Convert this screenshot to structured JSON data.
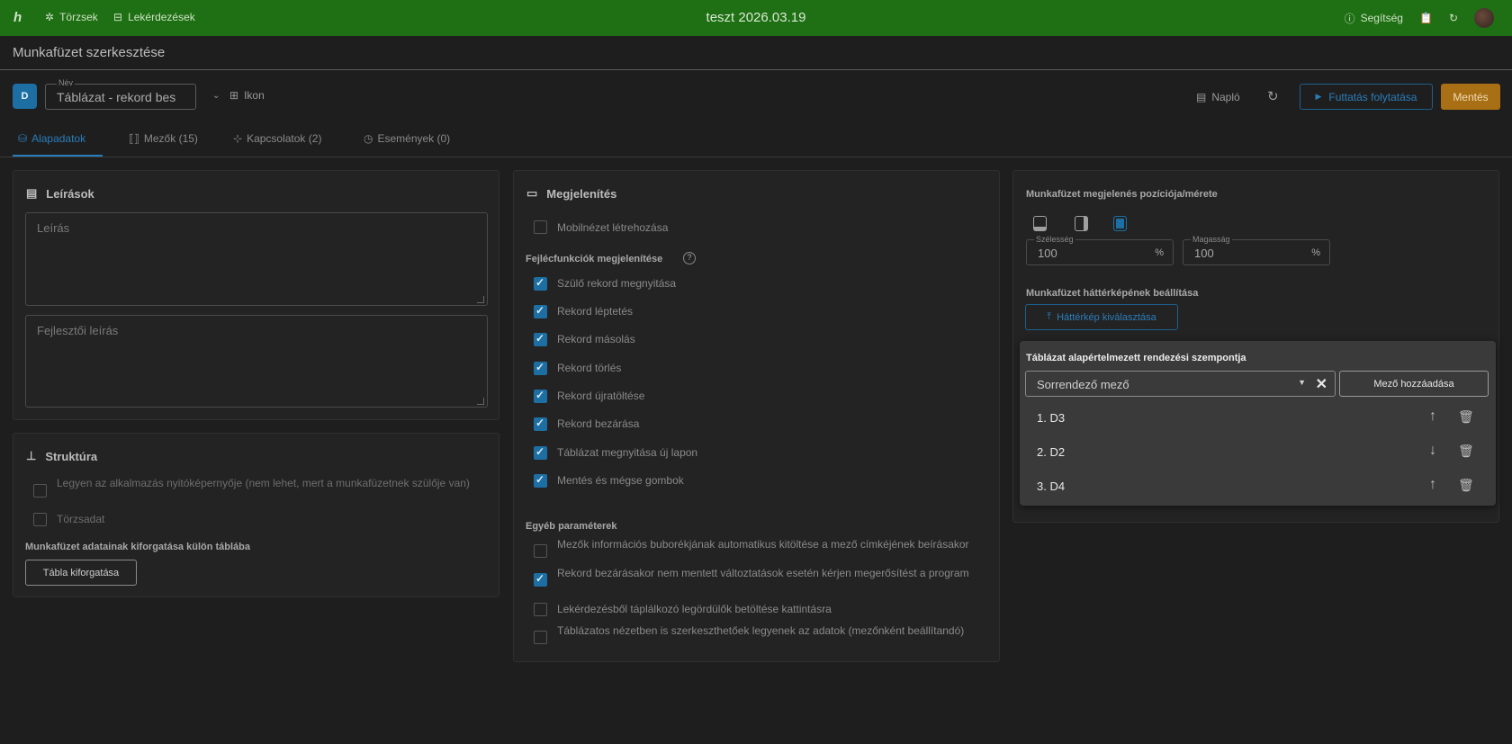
{
  "topbar": {
    "logo": "h",
    "nav_torzsek": "Törzsek",
    "nav_lekerdezesek": "Lekérdezések",
    "title": "teszt 2026.03.19",
    "help": "Segítség"
  },
  "header": {
    "page_title": "Munkafüzet szerkesztése",
    "badge": "D",
    "name_label": "Név",
    "name_value": "Táblázat - rekord bes",
    "icon_label": "Ikon",
    "log_label": "Napló",
    "run_label": "Futtatás folytatása",
    "save_label": "Mentés"
  },
  "tabs": [
    {
      "label": "Alapadatok",
      "active": true
    },
    {
      "label": "Mezők (15)"
    },
    {
      "label": "Kapcsolatok (2)"
    },
    {
      "label": "Események (0)"
    }
  ],
  "descriptions": {
    "title": "Leírások",
    "description_placeholder": "Leírás",
    "dev_description_placeholder": "Fejlesztői leírás"
  },
  "structure": {
    "title": "Struktúra",
    "start_screen": "Legyen az alkalmazás nyitóképernyője (nem lehet, mert a munkafüzetnek szülője van)",
    "master_data": "Törzsadat",
    "rollout_heading": "Munkafüzet adatainak kiforgatása külön táblába",
    "rollout_button": "Tábla kiforgatása"
  },
  "display": {
    "title": "Megjelenítés",
    "mobile_view": "Mobilnézet létrehozása",
    "header_functions_heading": "Fejlécfunkciók megjelenítése",
    "header_functions": [
      "Szülő rekord megnyitása",
      "Rekord léptetés",
      "Rekord másolás",
      "Rekord törlés",
      "Rekord újratöltése",
      "Rekord bezárása",
      "Táblázat megnyitása új lapon",
      "Mentés és mégse gombok"
    ],
    "other_params_heading": "Egyéb paraméterek",
    "other_params": [
      {
        "label": "Mezők információs buborékjának automatikus kitöltése a mező címkéjének beírásakor",
        "checked": false
      },
      {
        "label": "Rekord bezárásakor nem mentett változtatások esetén kérjen megerősítést a program",
        "checked": true
      },
      {
        "label": "Lekérdezésből táplálkozó legördülők betöltése kattintásra",
        "checked": false
      },
      {
        "label": "Táblázatos nézetben is szerkeszthetőek legyenek az adatok (mezőnként beállítandó)",
        "checked": false
      }
    ]
  },
  "position": {
    "heading": "Munkafüzet megjelenés pozíciója/mérete",
    "width_label": "Szélesség",
    "width_value": "100",
    "height_label": "Magasság",
    "height_value": "100",
    "unit": "%",
    "bg_heading": "Munkafüzet háttérképének beállítása",
    "bg_button": "Háttérkép kiválasztása"
  },
  "sort": {
    "heading": "Táblázat alapértelmezett rendezési szempontja",
    "select_placeholder": "Sorrendező mező",
    "add_button": "Mező hozzáadása",
    "rows": [
      {
        "label": "1. D3",
        "arrow": "↑"
      },
      {
        "label": "2. D2",
        "arrow": "↓"
      },
      {
        "label": "3. D4",
        "arrow": "↑"
      }
    ]
  }
}
